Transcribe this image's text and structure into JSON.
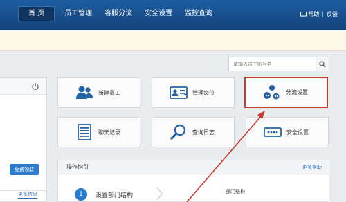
{
  "nav": {
    "items": [
      {
        "label": "首 页",
        "active": true
      },
      {
        "label": "员工管理"
      },
      {
        "label": "客服分流"
      },
      {
        "label": "安全设置"
      },
      {
        "label": "监控查询"
      }
    ],
    "help": "帮助",
    "feedback": "反馈"
  },
  "search": {
    "placeholder": "请输入员工账号名"
  },
  "left_panel": {
    "free_btn": "免费领取",
    "more_link": "更多信息"
  },
  "tiles": [
    {
      "label": "新建员工",
      "icon": "users-icon"
    },
    {
      "label": "管理岗位",
      "icon": "id-card-icon"
    },
    {
      "label": "分流设置",
      "icon": "distribution-icon"
    },
    {
      "label": "聊天记录",
      "icon": "chat-record-icon"
    },
    {
      "label": "查询日志",
      "icon": "search-log-icon"
    },
    {
      "label": "安全设置",
      "icon": "password-icon"
    }
  ],
  "guide": {
    "title": "操作指引",
    "more": "更多帮助",
    "step_num": "1",
    "step_label": "设置部门结构",
    "right_label": "部门结构"
  },
  "colors": {
    "header": "#1a5594",
    "accent": "#2a7ccf",
    "highlight": "#c8382c",
    "icon": "#2563a6"
  }
}
